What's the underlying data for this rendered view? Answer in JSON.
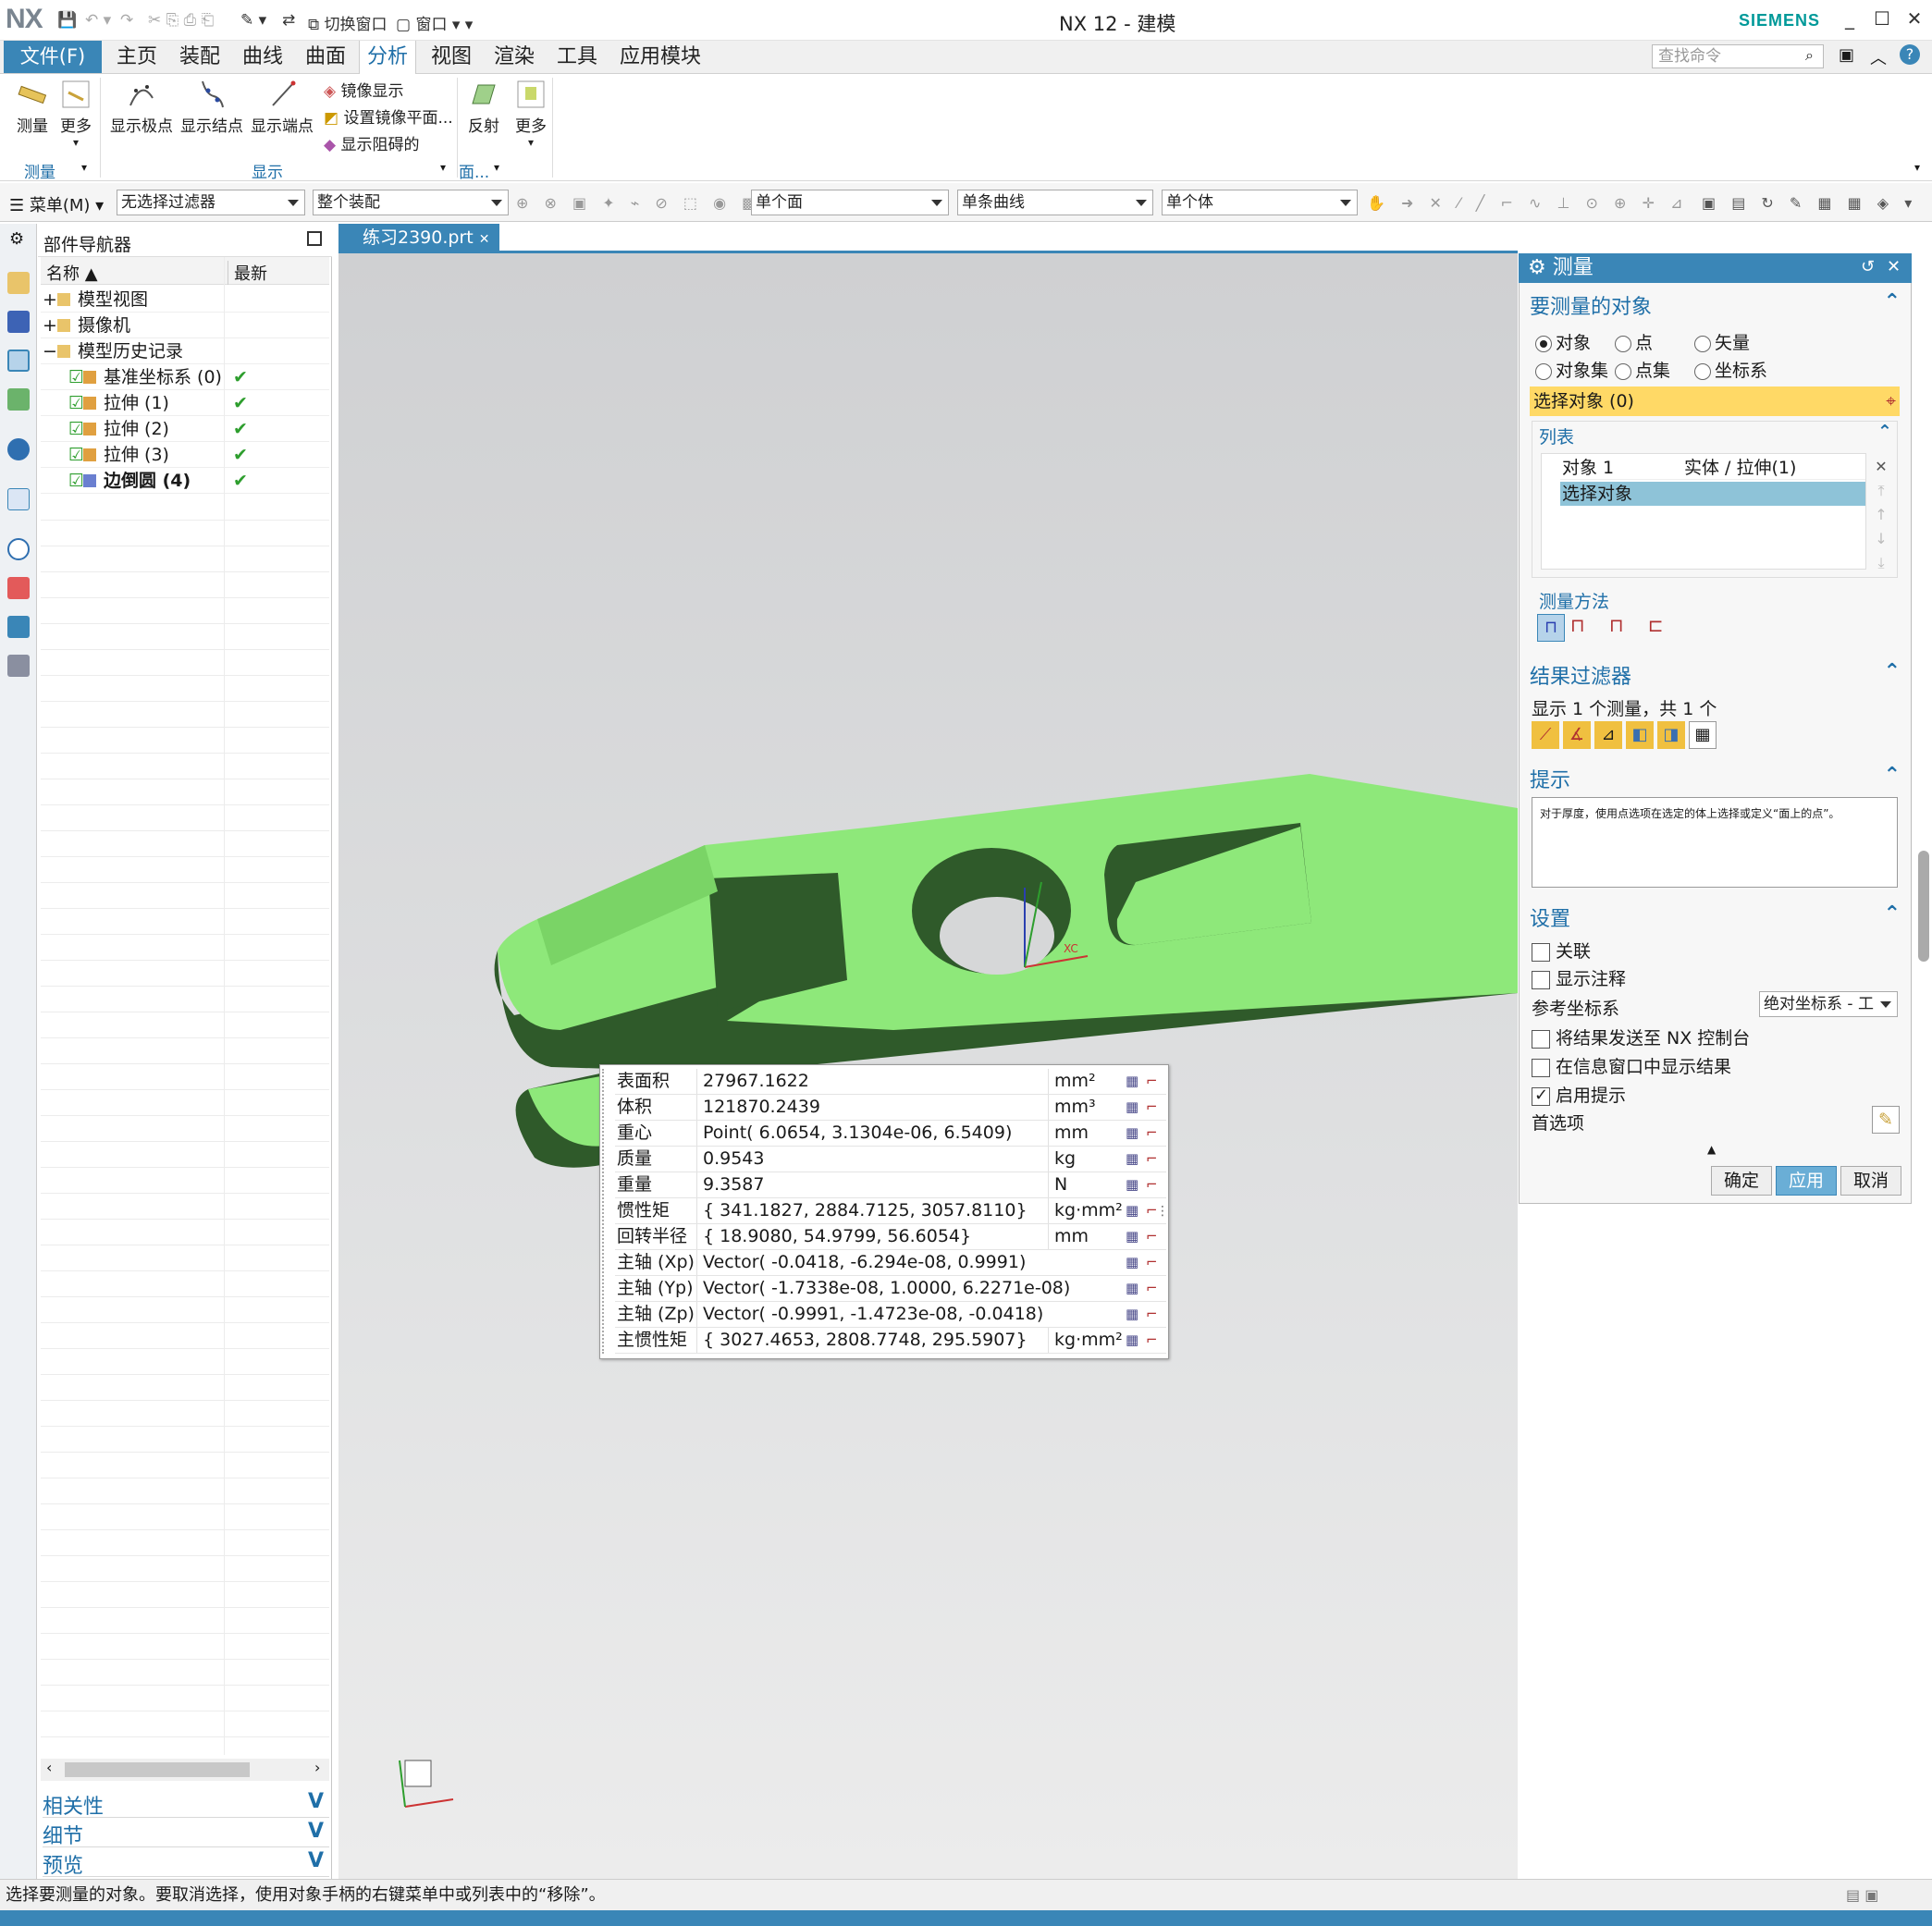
{
  "titlebar": {
    "logo": "NX",
    "switch_window": "切换窗口",
    "window_menu": "窗口",
    "title": "NX 12 - 建模",
    "brand": "SIEMENS",
    "min": "_",
    "max": "☐",
    "close": "✕",
    "help": "?"
  },
  "ribbon_tabs": {
    "file": "文件(F)",
    "tabs": [
      "主页",
      "装配",
      "曲线",
      "曲面",
      "分析",
      "视图",
      "渲染",
      "工具",
      "应用模块"
    ],
    "active": "分析",
    "search_placeholder": "查找命令"
  },
  "ribbon": {
    "measure": "测量",
    "more1": "更多",
    "show_poles": "显示极点",
    "show_knots": "显示结点",
    "show_ends": "显示端点",
    "mirror_display": "镜像显示",
    "set_mirror_plane": "设置镜像平面...",
    "show_blocked": "显示阻碍的",
    "reflection": "反射",
    "more2": "更多",
    "group_measure": "测量",
    "group_display": "显示",
    "group_face": "面..."
  },
  "filterbar": {
    "menu": "菜单(M)",
    "filter": "无选择过滤器",
    "assembly": "整个装配",
    "face_rule": "单个面",
    "curve_rule": "单条曲线",
    "body_rule": "单个体"
  },
  "navigator": {
    "title": "部件导航器",
    "col_name": "名称",
    "col_latest": "最新",
    "rows": [
      {
        "prefix": "+",
        "label": "模型视图",
        "check": ""
      },
      {
        "prefix": "+",
        "label": "摄像机",
        "check": ""
      },
      {
        "prefix": "−",
        "label": "模型历史记录",
        "check": ""
      },
      {
        "prefix": "",
        "label": "基准坐标系 (0)",
        "check": "✔"
      },
      {
        "prefix": "",
        "label": "拉伸 (1)",
        "check": "✔"
      },
      {
        "prefix": "",
        "label": "拉伸 (2)",
        "check": "✔"
      },
      {
        "prefix": "",
        "label": "拉伸 (3)",
        "check": "✔"
      },
      {
        "prefix": "",
        "label": "边倒圆 (4)",
        "check": "✔"
      }
    ],
    "sections": [
      "相关性",
      "细节",
      "预览"
    ]
  },
  "viewport": {
    "tab_label": "练习2390.prt",
    "axis_label": "XC"
  },
  "results": [
    {
      "name": "表面积",
      "value": "27967.1622",
      "unit": "mm²"
    },
    {
      "name": "体积",
      "value": "121870.2439",
      "unit": "mm³"
    },
    {
      "name": "重心",
      "value": "Point( 6.0654, 3.1304e-06, 6.5409)",
      "unit": "mm"
    },
    {
      "name": "质量",
      "value": "0.9543",
      "unit": "kg"
    },
    {
      "name": "重量",
      "value": "9.3587",
      "unit": "N"
    },
    {
      "name": "惯性矩",
      "value": "{ 341.1827, 2884.7125, 3057.8110}",
      "unit": "kg·mm²"
    },
    {
      "name": "回转半径",
      "value": "{ 18.9080, 54.9799, 56.6054}",
      "unit": "mm"
    },
    {
      "name": "主轴 (Xp)",
      "value": "Vector( -0.0418, -6.294e-08, 0.9991)",
      "unit": ""
    },
    {
      "name": "主轴 (Yp)",
      "value": "Vector( -1.7338e-08, 1.0000, 6.2271e-08)",
      "unit": ""
    },
    {
      "name": "主轴 (Zp)",
      "value": "Vector( -0.9991, -1.4723e-08, -0.0418)",
      "unit": ""
    },
    {
      "name": "主惯性矩",
      "value": "{ 3027.4653, 2808.7748, 295.5907}",
      "unit": "kg·mm²"
    }
  ],
  "dialog": {
    "title": "测量",
    "sec_objects": "要测量的对象",
    "radio_object": "对象",
    "radio_point": "点",
    "radio_vector": "矢量",
    "radio_objset": "对象集",
    "radio_pointset": "点集",
    "radio_csys": "坐标系",
    "select_object": "选择对象 (0)",
    "list_label": "列表",
    "list_rows": [
      {
        "c1": "对象 1",
        "c2": "实体 / 拉伸(1)"
      },
      {
        "c1": "选择对象",
        "c2": ""
      }
    ],
    "method_label": "测量方法",
    "sec_filter": "结果过滤器",
    "filter_summary": "显示 1 个测量，共 1 个",
    "sec_hint": "提示",
    "hint_text": "对于厚度，使用点选项在选定的体上选择或定义“面上的点”。",
    "sec_settings": "设置",
    "assoc": "关联",
    "show_annot": "显示注释",
    "ref_csys_label": "参考坐标系",
    "ref_csys_value": "绝对坐标系 - 工",
    "send_console": "将结果发送至 NX 控制台",
    "show_info": "在信息窗口中显示结果",
    "enable_hints": "启用提示",
    "preferences": "首选项",
    "ok": "确定",
    "apply": "应用",
    "cancel": "取消"
  },
  "status": {
    "text": "选择要测量的对象。要取消选择，使用对象手柄的右键菜单中或列表中的“移除”。"
  },
  "colors": {
    "accent": "#3a86b7",
    "part_green": "#8ee87a",
    "part_dark": "#2f5a2a",
    "select_yellow": "#ffd966"
  }
}
